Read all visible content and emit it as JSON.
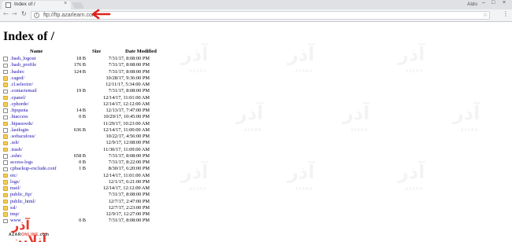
{
  "browser": {
    "tab_title": "Index of /",
    "tab_close": "×",
    "profile_name": "Aldo",
    "win_minimize": "–",
    "win_maximize": "□",
    "win_close": "×",
    "back": "←",
    "forward": "→",
    "reload": "↻",
    "info": "i",
    "url": "ftp://ftp.azarlearn.com",
    "star": "☆",
    "menu": "⋮"
  },
  "annotation": {
    "arrow_color": "#e0201a"
  },
  "page": {
    "heading": "Index of /",
    "columns": {
      "name": "Name",
      "size": "Size",
      "date": "Date Modified"
    },
    "entries": [
      {
        "name": ".bash_logout",
        "size": "18 B",
        "date": "7/31/17, 8:08:00 PM",
        "type": "file"
      },
      {
        "name": ".bash_profile",
        "size": "176 B",
        "date": "7/31/17, 8:08:00 PM",
        "type": "file"
      },
      {
        "name": ".bashrc",
        "size": "124 B",
        "date": "7/31/17, 8:08:00 PM",
        "type": "file"
      },
      {
        "name": ".caged/",
        "size": "",
        "date": "10/28/17, 9:36:00 PM",
        "type": "folder"
      },
      {
        "name": ".cl.selector/",
        "size": "",
        "date": "12/11/17, 5:34:00 AM",
        "type": "folder"
      },
      {
        "name": ".contactemail",
        "size": "19 B",
        "date": "7/31/17, 8:08:00 PM",
        "type": "file"
      },
      {
        "name": ".cpanel/",
        "size": "",
        "date": "12/14/17, 11:01:00 AM",
        "type": "folder"
      },
      {
        "name": ".cphorde/",
        "size": "",
        "date": "12/14/17, 12:12:00 AM",
        "type": "folder"
      },
      {
        "name": ".ftpquota",
        "size": "14 B",
        "date": "12/13/17, 7:47:00 PM",
        "type": "file"
      },
      {
        "name": ".htaccess",
        "size": "0 B",
        "date": "10/29/17, 10:45:00 PM",
        "type": "file"
      },
      {
        "name": ".htpasswds/",
        "size": "",
        "date": "11/29/17, 10:23:00 AM",
        "type": "folder"
      },
      {
        "name": ".lastlogin",
        "size": "636 B",
        "date": "12/14/17, 11:00:00 AM",
        "type": "file"
      },
      {
        "name": ".softaculous/",
        "size": "",
        "date": "10/22/17, 4:56:00 PM",
        "type": "folder"
      },
      {
        "name": ".ssh/",
        "size": "",
        "date": "12/9/17, 12:08:00 PM",
        "type": "folder"
      },
      {
        "name": ".trash/",
        "size": "",
        "date": "11/30/17, 11:09:00 AM",
        "type": "folder"
      },
      {
        "name": ".zshrc",
        "size": "658 B",
        "date": "7/31/17, 8:08:00 PM",
        "type": "file"
      },
      {
        "name": "access-logs",
        "size": "0 B",
        "date": "7/31/17, 8:22:00 PM",
        "type": "file"
      },
      {
        "name": "cpbackup-exclude.conf",
        "size": "1 B",
        "date": "8/30/17, 6:20:00 PM",
        "type": "file"
      },
      {
        "name": "etc/",
        "size": "",
        "date": "12/14/17, 11:01:00 AM",
        "type": "folder"
      },
      {
        "name": "logs/",
        "size": "",
        "date": "12/1/17, 6:21:00 PM",
        "type": "folder"
      },
      {
        "name": "mail/",
        "size": "",
        "date": "12/14/17, 12:12:00 AM",
        "type": "folder"
      },
      {
        "name": "public_ftp/",
        "size": "",
        "date": "7/31/17, 8:08:00 PM",
        "type": "folder"
      },
      {
        "name": "public_html/",
        "size": "",
        "date": "12/7/17, 2:47:00 PM",
        "type": "folder"
      },
      {
        "name": "ssl/",
        "size": "",
        "date": "12/7/17, 2:23:00 PM",
        "type": "folder"
      },
      {
        "name": "tmp/",
        "size": "",
        "date": "12/9/17, 12:27:00 PM",
        "type": "folder"
      },
      {
        "name": "www",
        "size": "0 B",
        "date": "7/31/17, 8:08:00 PM",
        "type": "file"
      }
    ]
  },
  "logo": {
    "word": "آذر آنلاین",
    "sub_a": "AZAR",
    "sub_b": "ONLINE",
    "sub_c": ".com"
  },
  "watermark": {
    "word": "آذر",
    "sub": "AZARA"
  },
  "colors": {
    "link": "#1a0dab",
    "folder": "#f5cd58",
    "brand_red": "#e63a2e"
  }
}
